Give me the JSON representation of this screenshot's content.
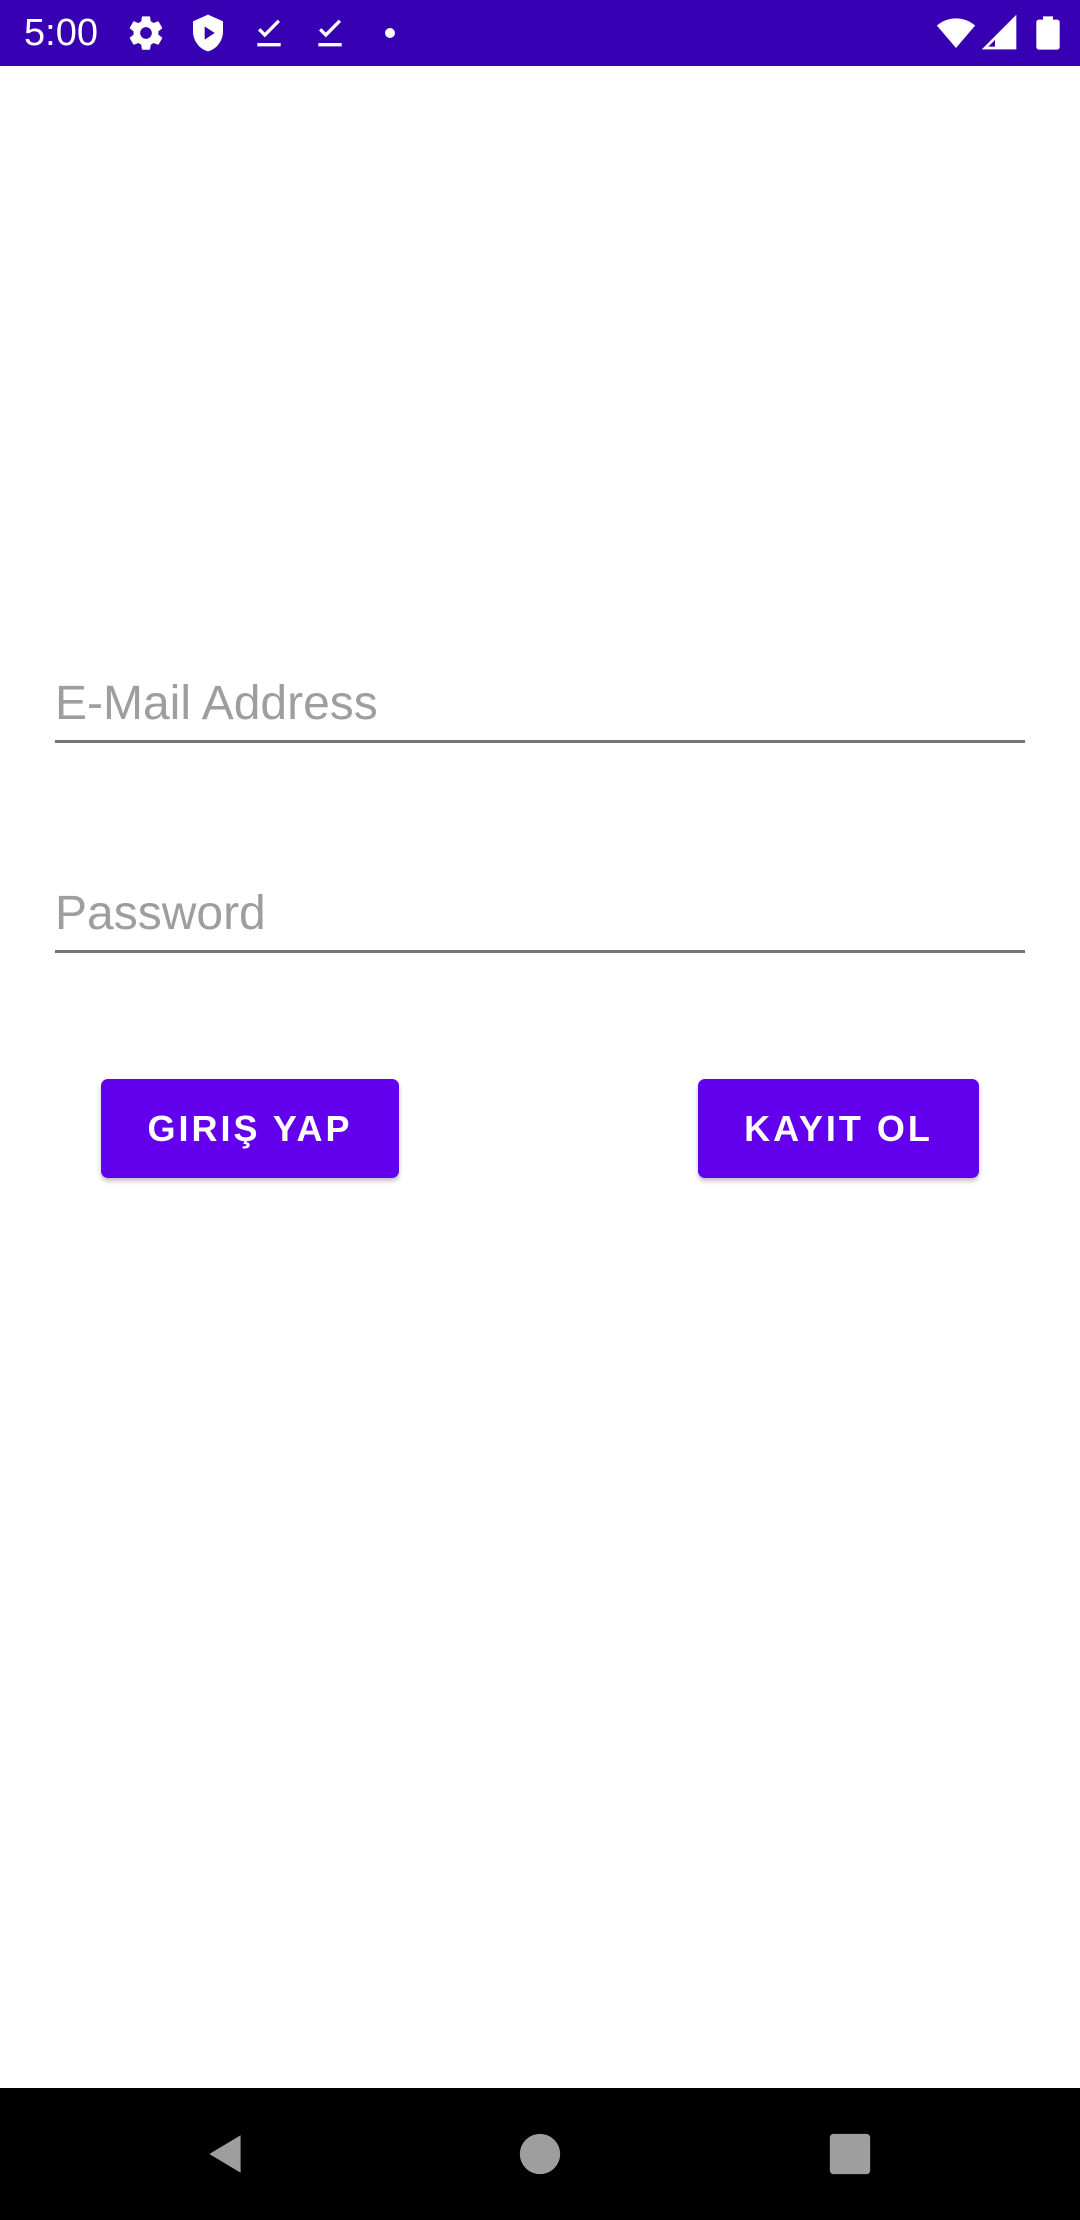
{
  "status_bar": {
    "time": "5:00",
    "background_color": "#3700b3",
    "left_icons": [
      "gear-icon",
      "shield-play-icon",
      "download-done-icon",
      "download-done-icon",
      "notification-dot-icon"
    ],
    "right_icons": [
      "wifi-icon",
      "cellular-signal-icon",
      "battery-icon"
    ]
  },
  "login_form": {
    "email": {
      "placeholder": "E-Mail Address",
      "value": ""
    },
    "password": {
      "placeholder": "Password",
      "value": ""
    },
    "login_button_label": "GIRIŞ YAP",
    "register_button_label": "KAYIT OL",
    "button_color": "#6200ee"
  },
  "nav_bar": {
    "icons": [
      "back-icon",
      "home-icon",
      "recents-icon"
    ]
  }
}
